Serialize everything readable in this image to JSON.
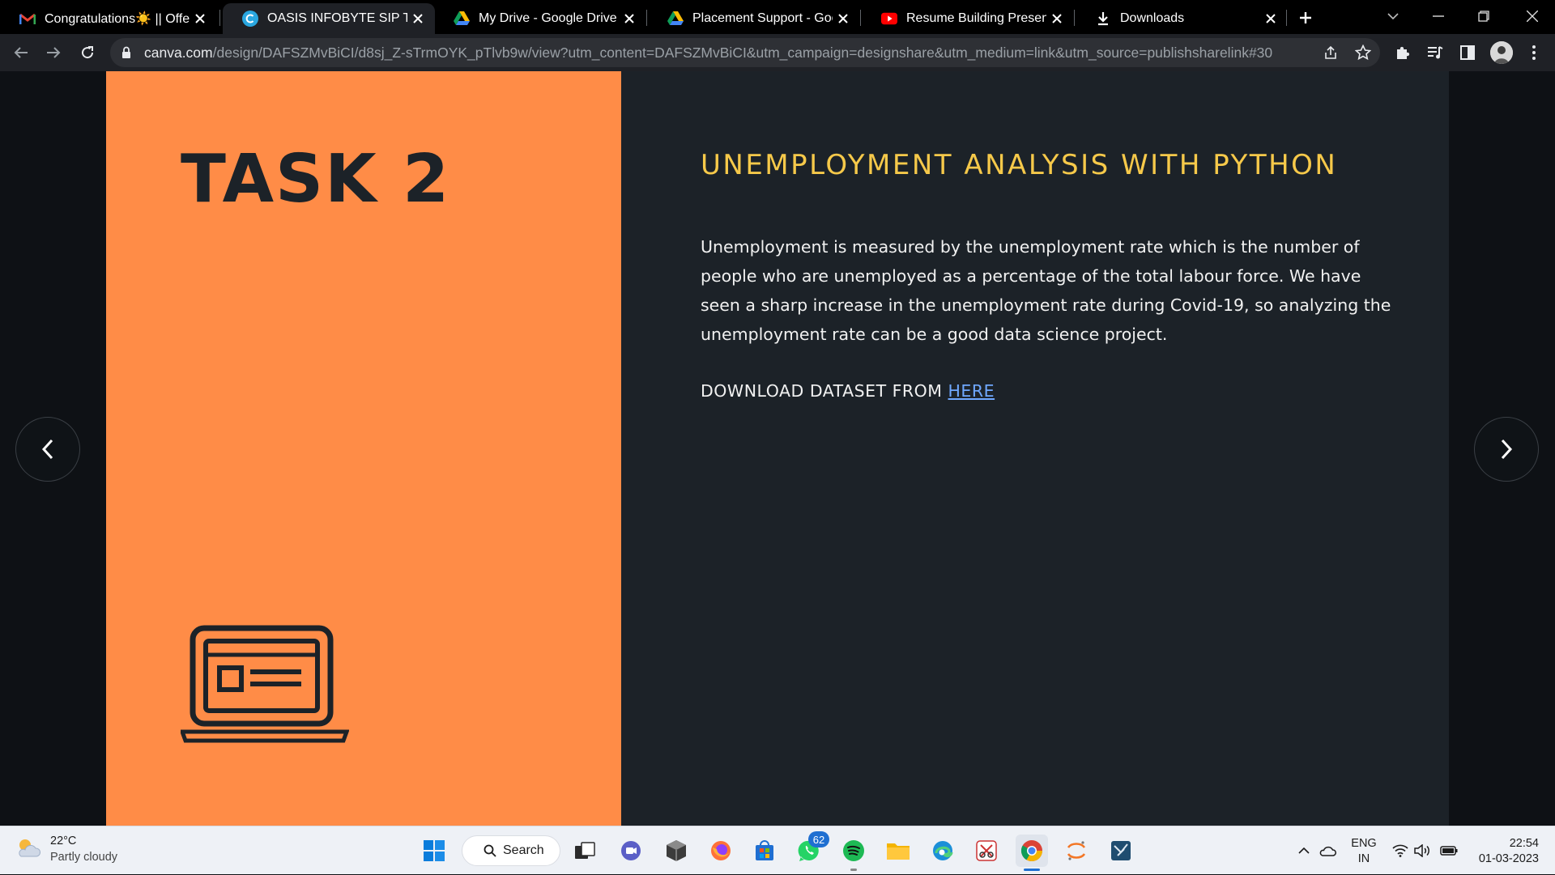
{
  "browser": {
    "tabs": [
      {
        "title": "Congratulations☀️ || Offer L",
        "favicon": "gmail-icon",
        "active": false
      },
      {
        "title": "OASIS INFOBYTE SIP TASK LI",
        "favicon": "canva-icon",
        "active": true
      },
      {
        "title": "My Drive - Google Drive",
        "favicon": "google-drive-icon",
        "active": false
      },
      {
        "title": "Placement Support - Googl",
        "favicon": "google-drive-icon",
        "active": false
      },
      {
        "title": "Resume Building Presentati",
        "favicon": "youtube-icon",
        "active": false
      },
      {
        "title": "Downloads",
        "favicon": "download-icon",
        "active": false
      }
    ],
    "address": {
      "host": "canva.com",
      "path": "/design/DAFSZMvBiCI/d8sj_Z-sTrmOYK_pTlvb9w/view?utm_content=DAFSZMvBiCI&utm_campaign=designshare&utm_medium=link&utm_source=publishsharelink#30"
    }
  },
  "slide": {
    "task_title": "TASK 2",
    "heading": "UNEMPLOYMENT ANALYSIS WITH PYTHON",
    "body": "Unemployment is measured by the unemployment rate which is the number of people who are unemployed as a percentage of the total labour force. We have seen a sharp increase in the unemployment rate during Covid-19, so analyzing the unemployment rate can be a good data science project.",
    "download_prefix": "DOWNLOAD DATASET FROM ",
    "download_link": "HERE",
    "colors": {
      "left_panel": "#ff8c47",
      "right_panel": "#1c2228",
      "heading": "#f6c94a",
      "link": "#6fa8ff"
    }
  },
  "taskbar": {
    "weather": {
      "temp": "22°C",
      "condition": "Partly cloudy"
    },
    "search_label": "Search",
    "whatsapp_badge": "62",
    "language": {
      "line1": "ENG",
      "line2": "IN"
    },
    "clock": {
      "time": "22:54",
      "date": "01-03-2023"
    }
  }
}
